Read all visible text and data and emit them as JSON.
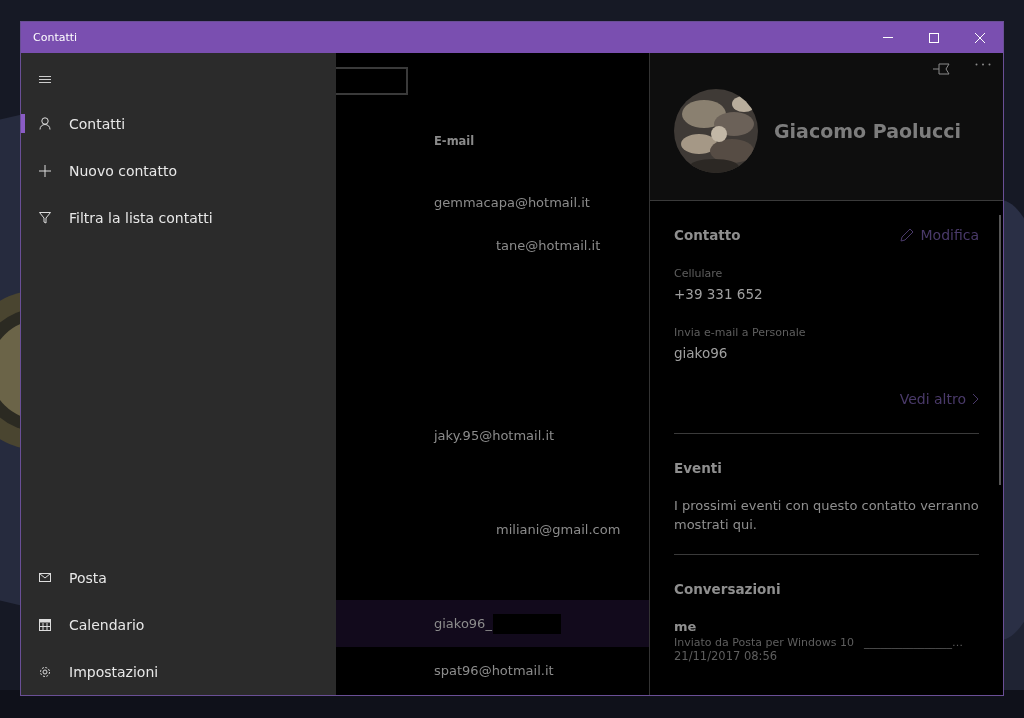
{
  "window": {
    "title": "Contatti"
  },
  "nav": {
    "items": [
      {
        "label": "Contatti",
        "kind": "person",
        "selected": true
      },
      {
        "label": "Nuovo contatto",
        "kind": "plus",
        "selected": false
      },
      {
        "label": "Filtra la lista contatti",
        "kind": "filter",
        "selected": false
      }
    ],
    "bottom_items": [
      {
        "label": "Posta",
        "kind": "mail",
        "selected": false
      },
      {
        "label": "Calendario",
        "kind": "calendar",
        "selected": false
      },
      {
        "label": "Impostazioni",
        "kind": "gear",
        "selected": false
      }
    ]
  },
  "list": {
    "columns": [
      "E-mail"
    ],
    "rows": [
      {
        "email": "gemmacapa@hotmail.it",
        "selected": false
      },
      {
        "email": "tane@hotmail.it",
        "selected": false
      },
      {
        "email": "jaky.95@hotmail.it",
        "selected": false
      },
      {
        "email": "miliani@gmail.com",
        "selected": false
      },
      {
        "email": "giako96_",
        "selected": true,
        "redacted": true
      },
      {
        "email": "spat96@hotmail.it",
        "selected": false
      }
    ]
  },
  "detail": {
    "name": "Giacomo Paolucci",
    "contact": {
      "title": "Contatto",
      "action": "Modifica",
      "fields": [
        {
          "label": "Cellulare",
          "value": "+39 331 652"
        },
        {
          "label": "Invia e-mail a Personale",
          "value": "giako96"
        }
      ],
      "more": "Vedi altro"
    },
    "events": {
      "title": "Eventi",
      "text": "I prossimi eventi con questo contatto verranno mostrati qui."
    },
    "conversations": {
      "title": "Conversazioni",
      "messages": [
        {
          "sender": "me",
          "preview": "Inviato da Posta per Windows 10",
          "preview_tail": "________________…",
          "date": "21/11/2017 08:56"
        }
      ]
    }
  }
}
